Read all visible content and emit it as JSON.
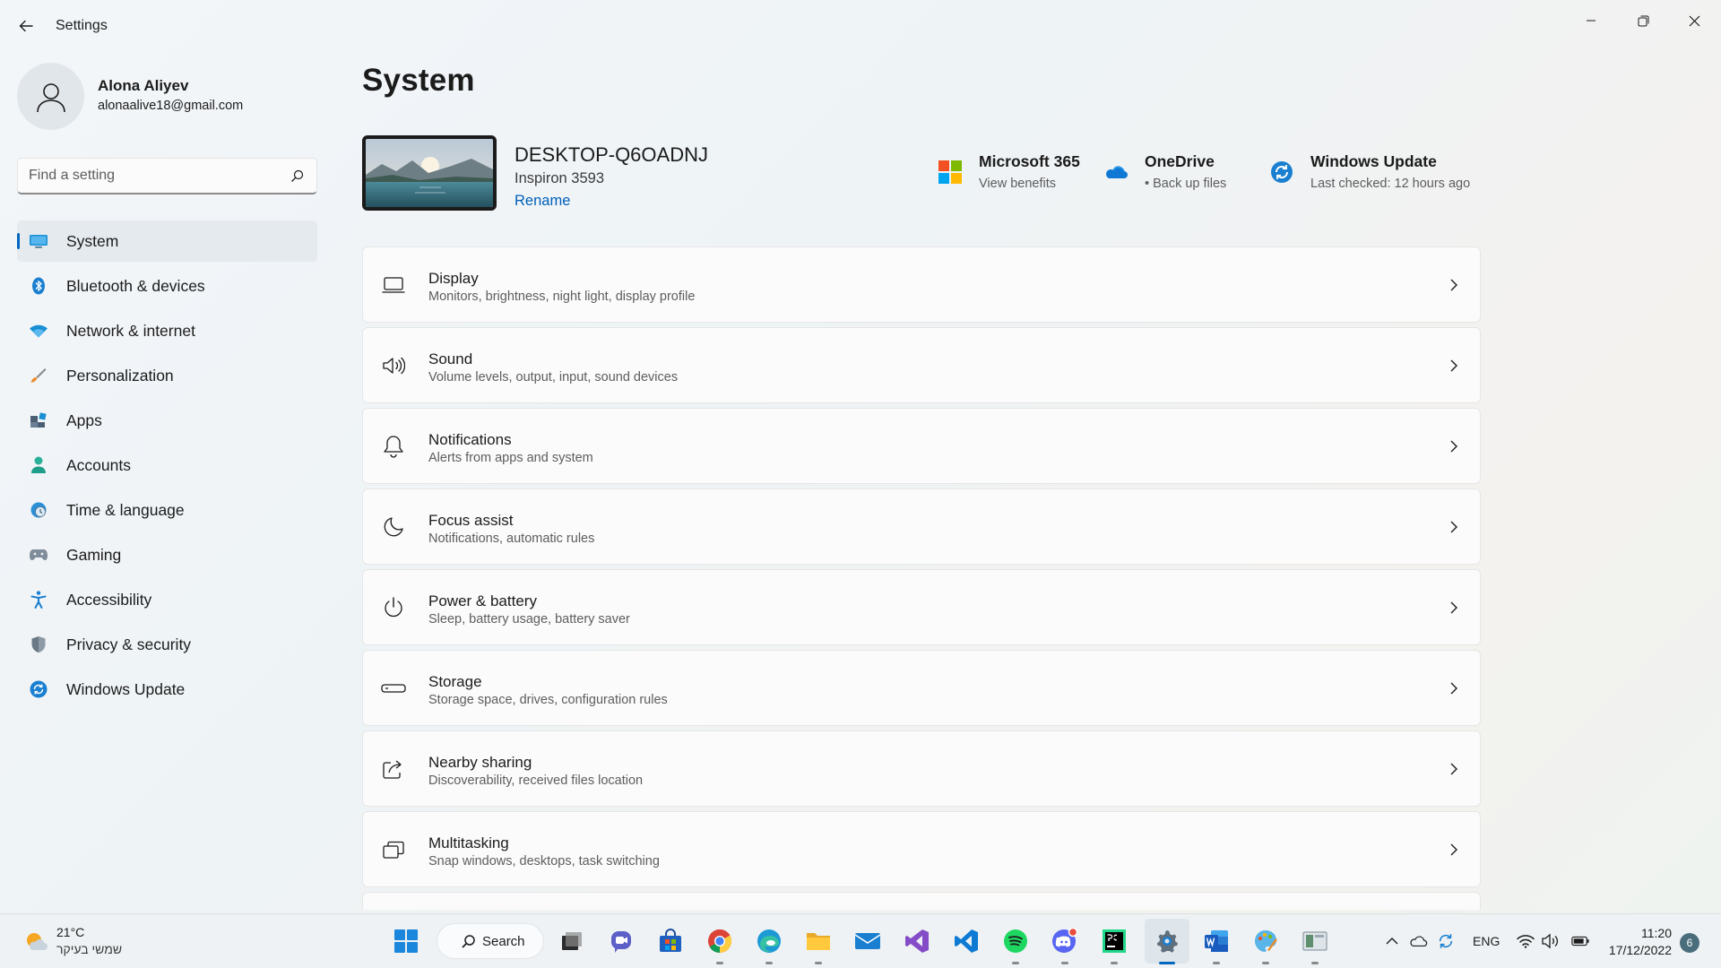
{
  "window": {
    "title": "Settings"
  },
  "user": {
    "name": "Alona Aliyev",
    "email": "alonaalive18@gmail.com"
  },
  "search": {
    "placeholder": "Find a setting"
  },
  "sidebar": {
    "items": [
      {
        "label": "System",
        "icon": "system-icon",
        "active": true
      },
      {
        "label": "Bluetooth & devices",
        "icon": "bluetooth-icon"
      },
      {
        "label": "Network & internet",
        "icon": "wifi-icon"
      },
      {
        "label": "Personalization",
        "icon": "brush-icon"
      },
      {
        "label": "Apps",
        "icon": "apps-icon"
      },
      {
        "label": "Accounts",
        "icon": "person-icon"
      },
      {
        "label": "Time & language",
        "icon": "globe-clock-icon"
      },
      {
        "label": "Gaming",
        "icon": "gamepad-icon"
      },
      {
        "label": "Accessibility",
        "icon": "accessibility-icon"
      },
      {
        "label": "Privacy & security",
        "icon": "shield-icon"
      },
      {
        "label": "Windows Update",
        "icon": "sync-icon"
      }
    ]
  },
  "main": {
    "title": "System",
    "device": {
      "name": "DESKTOP-Q6OADNJ",
      "model": "Inspiron 3593",
      "rename_label": "Rename"
    },
    "quick_links": [
      {
        "title": "Microsoft 365",
        "subtitle": "View benefits",
        "icon": "microsoft-logo-icon"
      },
      {
        "title": "OneDrive",
        "subtitle": "• Back up files",
        "icon": "onedrive-cloud-icon"
      },
      {
        "title": "Windows Update",
        "subtitle": "Last checked: 12 hours ago",
        "icon": "windows-update-icon"
      }
    ],
    "cards": [
      {
        "title": "Display",
        "subtitle": "Monitors, brightness, night light, display profile",
        "icon": "laptop-icon"
      },
      {
        "title": "Sound",
        "subtitle": "Volume levels, output, input, sound devices",
        "icon": "speaker-icon"
      },
      {
        "title": "Notifications",
        "subtitle": "Alerts from apps and system",
        "icon": "bell-icon"
      },
      {
        "title": "Focus assist",
        "subtitle": "Notifications, automatic rules",
        "icon": "moon-icon"
      },
      {
        "title": "Power & battery",
        "subtitle": "Sleep, battery usage, battery saver",
        "icon": "power-icon"
      },
      {
        "title": "Storage",
        "subtitle": "Storage space, drives, configuration rules",
        "icon": "storage-icon"
      },
      {
        "title": "Nearby sharing",
        "subtitle": "Discoverability, received files location",
        "icon": "share-icon"
      },
      {
        "title": "Multitasking",
        "subtitle": "Snap windows, desktops, task switching",
        "icon": "multitasking-icon"
      }
    ]
  },
  "taskbar": {
    "weather_temp": "21°C",
    "weather_desc": "שמשי בעיקר",
    "search_label": "Search",
    "language": "ENG",
    "time": "11:20",
    "date": "17/12/2022",
    "notification_count": "6"
  },
  "colors": {
    "accent": "#0067c0",
    "link": "#005fb8"
  }
}
